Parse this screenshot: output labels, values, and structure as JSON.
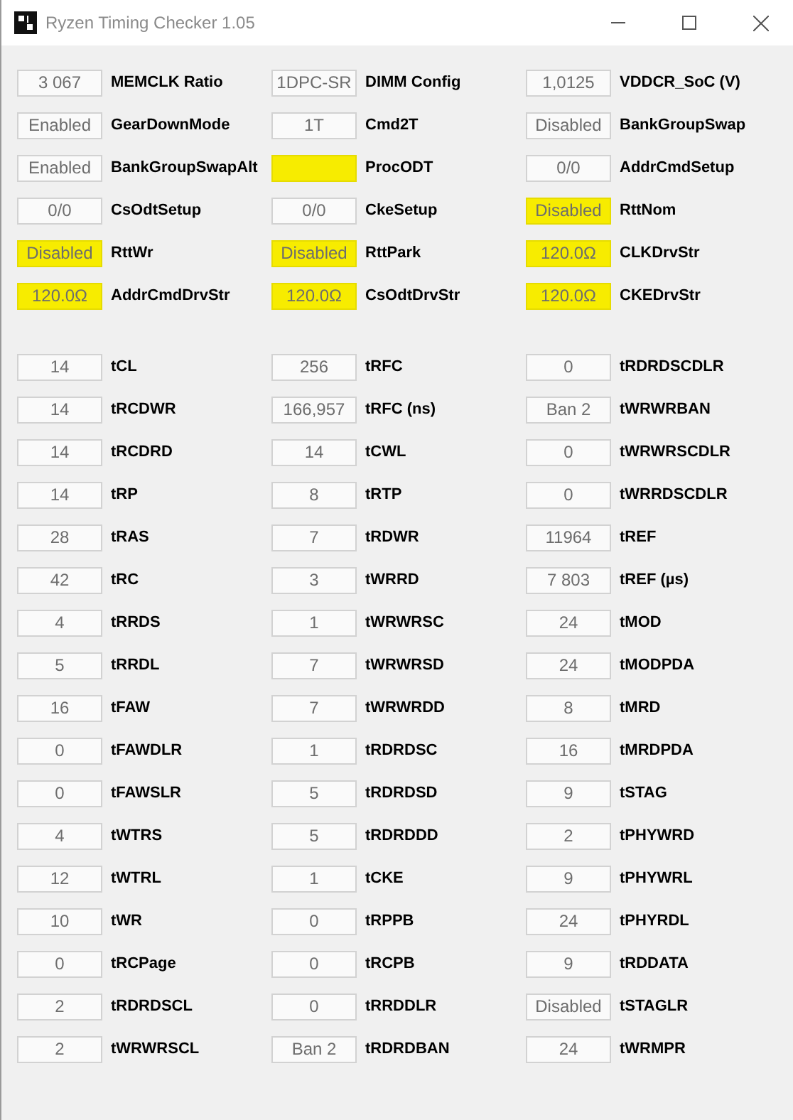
{
  "window": {
    "title": "Ryzen Timing Checker 1.05"
  },
  "general": [
    {
      "value": "3 067",
      "label": "MEMCLK Ratio",
      "highlighted": false
    },
    {
      "value": "1DPC-SR",
      "label": "DIMM Config",
      "highlighted": false
    },
    {
      "value": "1,0125",
      "label": "VDDCR_SoC (V)",
      "highlighted": false
    },
    {
      "value": "Enabled",
      "label": "GearDownMode",
      "highlighted": false
    },
    {
      "value": "1T",
      "label": "Cmd2T",
      "highlighted": false
    },
    {
      "value": "Disabled",
      "label": "BankGroupSwap",
      "highlighted": false
    },
    {
      "value": "Enabled",
      "label": "BankGroupSwapAlt",
      "highlighted": false
    },
    {
      "label": "ProcODT",
      "highlighted": true
    },
    {
      "value": "0/0",
      "label": "AddrCmdSetup",
      "highlighted": false
    },
    {
      "value": "0/0",
      "label": "CsOdtSetup",
      "highlighted": false
    },
    {
      "value": "0/0",
      "label": "CkeSetup",
      "highlighted": false
    },
    {
      "value": "Disabled",
      "label": "RttNom",
      "highlighted": true
    },
    {
      "value": "Disabled",
      "label": "RttWr",
      "highlighted": true
    },
    {
      "value": "Disabled",
      "label": "RttPark",
      "highlighted": true
    },
    {
      "value": "120.0Ω",
      "label": "CLKDrvStr",
      "highlighted": true
    },
    {
      "value": "120.0Ω",
      "label": "AddrCmdDrvStr",
      "highlighted": true
    },
    {
      "value": "120.0Ω",
      "label": "CsOdtDrvStr",
      "highlighted": true
    },
    {
      "value": "120.0Ω",
      "label": "CKEDrvStr",
      "highlighted": true
    }
  ],
  "timings": [
    {
      "value": "14",
      "label": "tCL"
    },
    {
      "value": "256",
      "label": "tRFC"
    },
    {
      "value": "0",
      "label": "tRDRDSCDLR"
    },
    {
      "value": "14",
      "label": "tRCDWR"
    },
    {
      "value": "166,957",
      "label": "tRFC (ns)"
    },
    {
      "value": "Ban 2",
      "label": "tWRWRBAN"
    },
    {
      "value": "14",
      "label": "tRCDRD"
    },
    {
      "value": "14",
      "label": "tCWL"
    },
    {
      "value": "0",
      "label": "tWRWRSCDLR"
    },
    {
      "value": "14",
      "label": "tRP"
    },
    {
      "value": "8",
      "label": "tRTP"
    },
    {
      "value": "0",
      "label": "tWRRDSCDLR"
    },
    {
      "value": "28",
      "label": "tRAS"
    },
    {
      "value": "7",
      "label": "tRDWR"
    },
    {
      "value": "11964",
      "label": "tREF"
    },
    {
      "value": "42",
      "label": "tRC"
    },
    {
      "value": "3",
      "label": "tWRRD"
    },
    {
      "value": "7 803",
      "label": "tREF (µs)"
    },
    {
      "value": "4",
      "label": "tRRDS"
    },
    {
      "value": "1",
      "label": "tWRWRSC"
    },
    {
      "value": "24",
      "label": "tMOD"
    },
    {
      "value": "5",
      "label": "tRRDL"
    },
    {
      "value": "7",
      "label": "tWRWRSD"
    },
    {
      "value": "24",
      "label": "tMODPDA"
    },
    {
      "value": "16",
      "label": "tFAW"
    },
    {
      "value": "7",
      "label": "tWRWRDD"
    },
    {
      "value": "8",
      "label": "tMRD"
    },
    {
      "value": "0",
      "label": "tFAWDLR"
    },
    {
      "value": "1",
      "label": "tRDRDSC"
    },
    {
      "value": "16",
      "label": "tMRDPDA"
    },
    {
      "value": "0",
      "label": "tFAWSLR"
    },
    {
      "value": "5",
      "label": "tRDRDSD"
    },
    {
      "value": "9",
      "label": "tSTAG"
    },
    {
      "value": "4",
      "label": "tWTRS"
    },
    {
      "value": "5",
      "label": "tRDRDDD"
    },
    {
      "value": "2",
      "label": "tPHYWRD"
    },
    {
      "value": "12",
      "label": "tWTRL"
    },
    {
      "value": "1",
      "label": "tCKE"
    },
    {
      "value": "9",
      "label": "tPHYWRL"
    },
    {
      "value": "10",
      "label": "tWR"
    },
    {
      "value": "0",
      "label": "tRPPB"
    },
    {
      "value": "24",
      "label": "tPHYRDL"
    },
    {
      "value": "0",
      "label": "tRCPage"
    },
    {
      "value": "0",
      "label": "tRCPB"
    },
    {
      "value": "9",
      "label": "tRDDATA"
    },
    {
      "value": "2",
      "label": "tRDRDSCL"
    },
    {
      "value": "0",
      "label": "tRRDDLR"
    },
    {
      "value": "Disabled",
      "label": "tSTAGLR"
    },
    {
      "value": "2",
      "label": "tWRWRSCL"
    },
    {
      "value": "Ban 2",
      "label": "tRDRDBAN"
    },
    {
      "value": "24",
      "label": "tWRMPR"
    }
  ]
}
